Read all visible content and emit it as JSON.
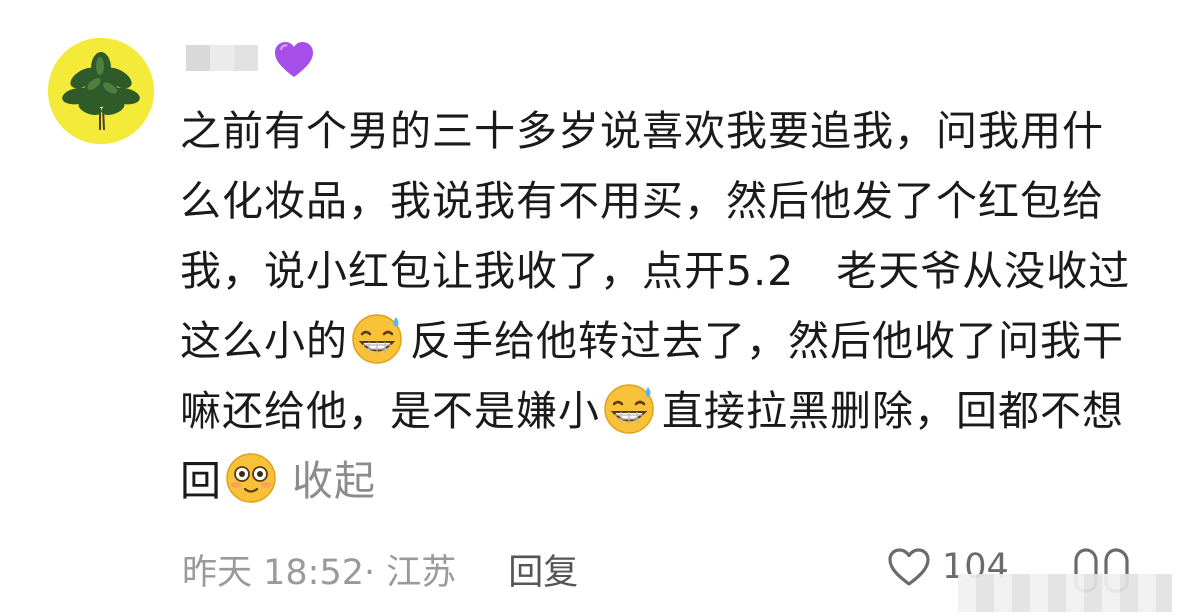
{
  "comment": {
    "badge_icon": "purple-heart-icon",
    "content_parts": [
      "之前有个男的三十多岁说喜欢我要追我，问我用什么化妆品，我说我有不用买，然后他发了个红包给我，说小红包让我收了，点开5.2　老天爷从没收过这么小的",
      "反手给他转过去了，然后他收了问我干嘛还给他，是不是嫌小",
      "直接拉黑删除，回都不想回"
    ],
    "emojis": [
      "grin-sweat-emoji",
      "grin-sweat-emoji",
      "flushed-emoji"
    ],
    "collapse_label": "收起",
    "time_location": "昨天 18:52· 江苏",
    "reply_label": "回复",
    "like_count": "104",
    "like_icon": "heart-outline-icon",
    "dislike_icon": "dislike-icon"
  },
  "colors": {
    "avatar_bg": "#f3ea3a",
    "badge": "#a64ee8",
    "text": "#1a1a1a",
    "meta": "#9a9a9a"
  }
}
